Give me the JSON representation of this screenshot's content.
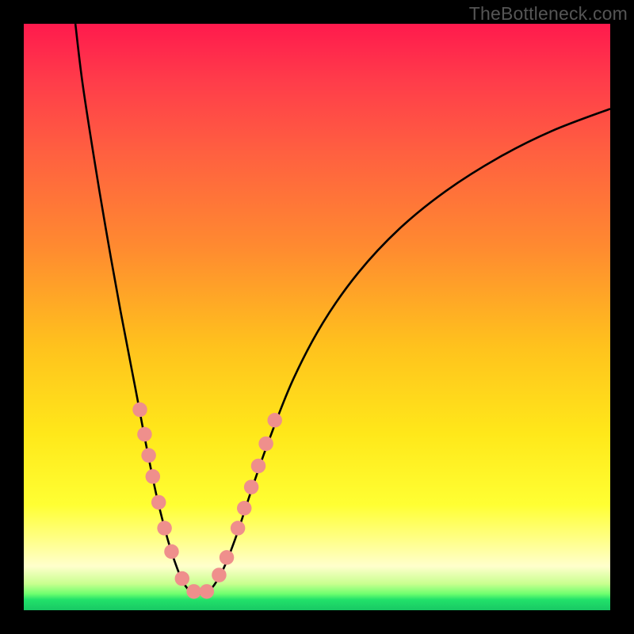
{
  "watermark": "TheBottleneck.com",
  "chart_data": {
    "type": "line",
    "title": "",
    "xlabel": "",
    "ylabel": "",
    "xlim": [
      0,
      100
    ],
    "ylim": [
      0,
      100
    ],
    "grid": false,
    "legend": false,
    "curve_description": "Asymmetric V-shaped bottleneck curve with minimum near x≈29; steeper rise on left side, gentler convex rise on right side.",
    "curve_points_normalized": [
      {
        "x": 8.8,
        "y": 0.0
      },
      {
        "x": 10.0,
        "y": 10.0
      },
      {
        "x": 12.0,
        "y": 23.0
      },
      {
        "x": 14.0,
        "y": 35.0
      },
      {
        "x": 16.5,
        "y": 49.0
      },
      {
        "x": 19.0,
        "y": 62.0
      },
      {
        "x": 21.0,
        "y": 72.5
      },
      {
        "x": 23.0,
        "y": 82.0
      },
      {
        "x": 25.5,
        "y": 91.0
      },
      {
        "x": 28.0,
        "y": 96.4
      },
      {
        "x": 31.0,
        "y": 97.0
      },
      {
        "x": 33.5,
        "y": 94.0
      },
      {
        "x": 36.0,
        "y": 88.0
      },
      {
        "x": 39.0,
        "y": 79.0
      },
      {
        "x": 42.0,
        "y": 70.5
      },
      {
        "x": 46.0,
        "y": 60.5
      },
      {
        "x": 51.0,
        "y": 51.0
      },
      {
        "x": 57.0,
        "y": 42.5
      },
      {
        "x": 64.0,
        "y": 35.0
      },
      {
        "x": 72.0,
        "y": 28.5
      },
      {
        "x": 81.0,
        "y": 22.8
      },
      {
        "x": 90.0,
        "y": 18.3
      },
      {
        "x": 100.0,
        "y": 14.5
      }
    ],
    "marker_radius_pct": 1.25,
    "markers_normalized_left": [
      {
        "x": 19.8,
        "y": 65.8
      },
      {
        "x": 20.6,
        "y": 70.0
      },
      {
        "x": 21.3,
        "y": 73.6
      },
      {
        "x": 22.0,
        "y": 77.2
      },
      {
        "x": 23.0,
        "y": 81.6
      },
      {
        "x": 24.0,
        "y": 86.0
      },
      {
        "x": 25.2,
        "y": 90.0
      },
      {
        "x": 27.0,
        "y": 94.6
      },
      {
        "x": 29.0,
        "y": 96.8
      }
    ],
    "markers_normalized_right": [
      {
        "x": 31.2,
        "y": 96.8
      },
      {
        "x": 33.3,
        "y": 94.0
      },
      {
        "x": 34.6,
        "y": 91.0
      },
      {
        "x": 36.5,
        "y": 86.0
      },
      {
        "x": 37.6,
        "y": 82.6
      },
      {
        "x": 38.8,
        "y": 79.0
      },
      {
        "x": 40.0,
        "y": 75.4
      },
      {
        "x": 41.3,
        "y": 71.6
      },
      {
        "x": 42.8,
        "y": 67.6
      }
    ]
  }
}
